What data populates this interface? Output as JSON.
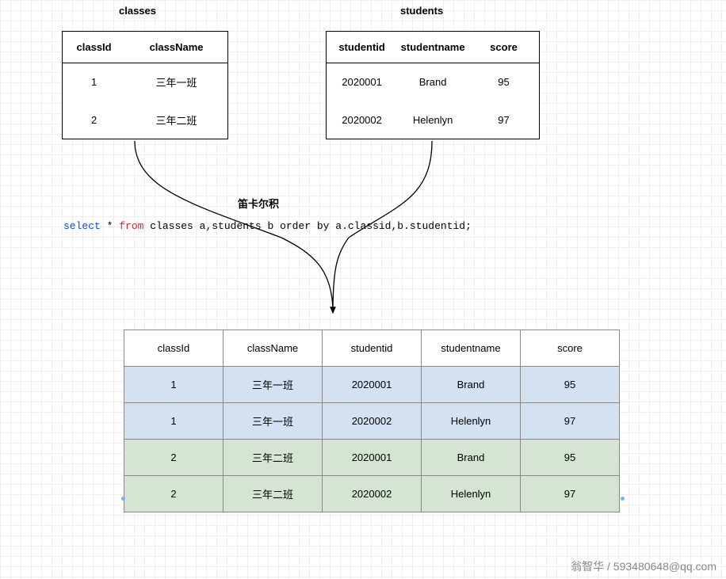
{
  "classes": {
    "title": "classes",
    "headers": [
      "classId",
      "className"
    ],
    "rows": [
      [
        "1",
        "三年一班"
      ],
      [
        "2",
        "三年二班"
      ]
    ]
  },
  "students": {
    "title": "students",
    "headers": [
      "studentid",
      "studentname",
      "score"
    ],
    "rows": [
      [
        "2020001",
        "Brand",
        "95"
      ],
      [
        "2020002",
        "Helenlyn",
        "97"
      ]
    ]
  },
  "cartesian_label": "笛卡尔积",
  "sql": {
    "select": "select",
    "star_from": " * ",
    "from": "from",
    "rest": " classes a,students b order by a.classid,b.studentid;"
  },
  "result": {
    "headers": [
      "classId",
      "className",
      "studentid",
      "studentname",
      "score"
    ],
    "rows": [
      {
        "group": "blue",
        "cells": [
          "1",
          "三年一班",
          "2020001",
          "Brand",
          "95"
        ]
      },
      {
        "group": "blue",
        "cells": [
          "1",
          "三年一班",
          "2020002",
          "Helenlyn",
          "97"
        ]
      },
      {
        "group": "green",
        "cells": [
          "2",
          "三年二班",
          "2020001",
          "Brand",
          "95"
        ]
      },
      {
        "group": "green",
        "cells": [
          "2",
          "三年二班",
          "2020002",
          "Helenlyn",
          "97"
        ]
      }
    ]
  },
  "footer": "翁智华 / 593480648@qq.com"
}
